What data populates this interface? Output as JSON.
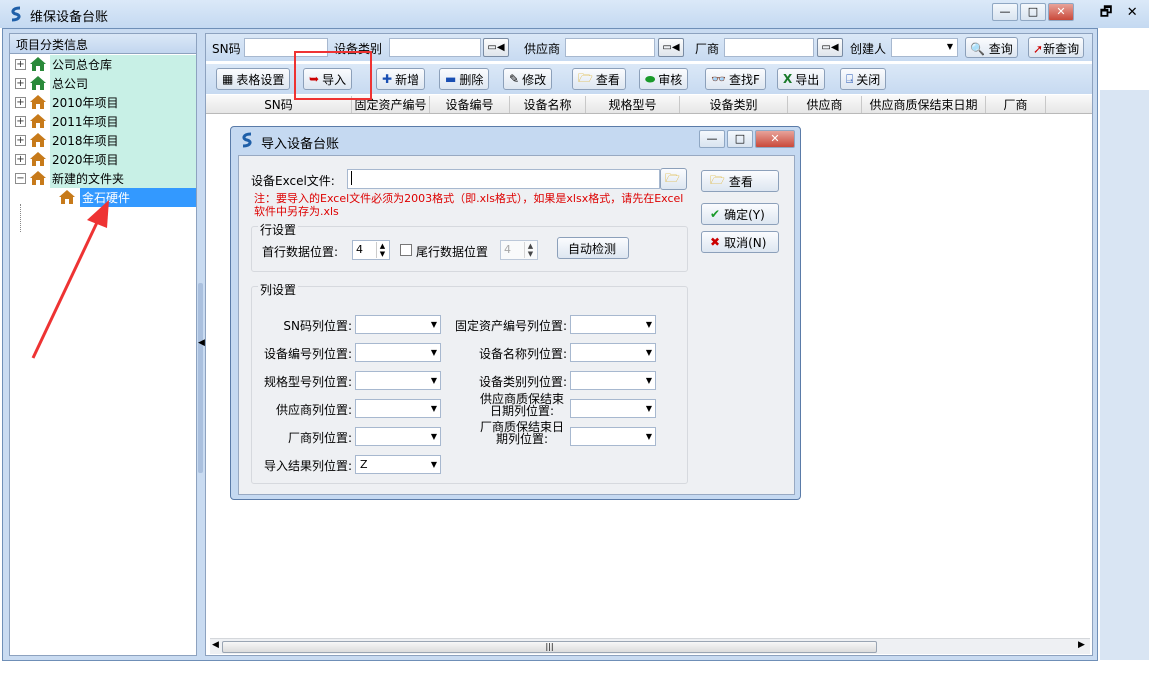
{
  "window": {
    "title": "维保设备台账",
    "min": "—",
    "max": "□",
    "close": "✕",
    "outer_restore": "🗗",
    "outer_close": "✕"
  },
  "tree": {
    "header": "项目分类信息",
    "items": [
      {
        "label": "公司总仓库",
        "expander": "+"
      },
      {
        "label": "总公司",
        "expander": "+"
      },
      {
        "label": "2010年项目",
        "expander": "+"
      },
      {
        "label": "2011年项目",
        "expander": "+"
      },
      {
        "label": "2018年项目",
        "expander": "+"
      },
      {
        "label": "2020年项目",
        "expander": "+"
      },
      {
        "label": "新建的文件夹",
        "expander": "−"
      },
      {
        "label": "金石硬件",
        "expander": ""
      }
    ]
  },
  "search": {
    "sn_label": "SN码",
    "type_label": "设备类别",
    "supplier_label": "供应商",
    "maker_label": "厂商",
    "creator_label": "创建人",
    "query": "查询",
    "new_query": "新查询"
  },
  "toolbar": {
    "table_settings": "表格设置",
    "import": "导入",
    "add": "新增",
    "delete": "删除",
    "edit": "修改",
    "view": "查看",
    "audit": "审核",
    "find": "查找F",
    "export": "导出",
    "close": "关闭"
  },
  "grid": {
    "columns": [
      "SN码",
      "固定资产编号",
      "设备编号",
      "设备名称",
      "规格型号",
      "设备类别",
      "供应商",
      "供应商质保结束日期",
      "厂商"
    ]
  },
  "dialog": {
    "title": "导入设备台账",
    "file_label": "设备Excel文件:",
    "file_value": "",
    "note": "注：要导入的Excel文件必须为2003格式（即.xls格式），如果是xlsx格式，请先在Excel软件中另存为.xls",
    "row_group": "行设置",
    "first_row_label": "首行数据位置:",
    "first_row_value": "4",
    "last_row_label": "尾行数据位置",
    "last_row_value": "4",
    "auto_detect": "自动检测",
    "col_group": "列设置",
    "fields": {
      "sn": "SN码列位置:",
      "asset": "固定资产编号列位置:",
      "code": "设备编号列位置:",
      "name": "设备名称列位置:",
      "spec": "规格型号列位置:",
      "type": "设备类别列位置:",
      "supplier": "供应商列位置:",
      "supplier_warranty": "供应商质保结束日期列位置:",
      "maker": "厂商列位置:",
      "maker_warranty": "厂商质保结束日期列位置:",
      "result": "导入结果列位置:"
    },
    "result_value": "Z",
    "view_btn": "查看",
    "ok_btn": "确定(Y)",
    "cancel_btn": "取消(N)"
  }
}
